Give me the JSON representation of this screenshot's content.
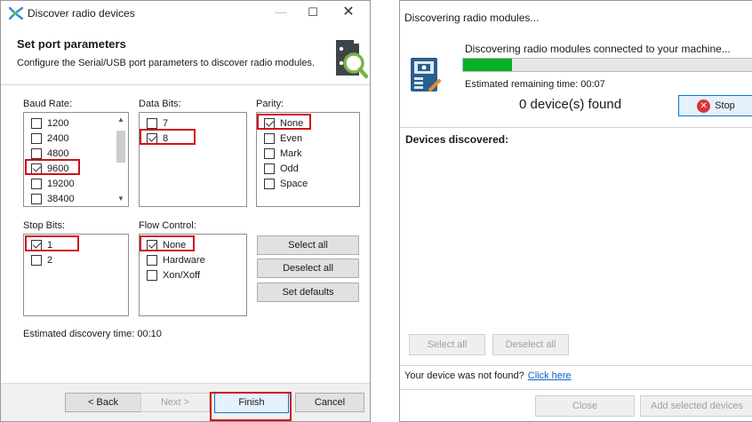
{
  "left_window": {
    "title": "Discover radio devices",
    "title_controls": {
      "minimize": "—",
      "maximize": "☐",
      "close": "✕"
    },
    "heading": "Set port parameters",
    "subheading": "Configure the Serial/USB port parameters to discover radio modules.",
    "baud_rate": {
      "label": "Baud Rate:",
      "options": [
        {
          "label": "1200",
          "checked": false
        },
        {
          "label": "2400",
          "checked": false
        },
        {
          "label": "4800",
          "checked": false
        },
        {
          "label": "9600",
          "checked": true
        },
        {
          "label": "19200",
          "checked": false
        },
        {
          "label": "38400",
          "checked": false
        }
      ]
    },
    "data_bits": {
      "label": "Data Bits:",
      "options": [
        {
          "label": "7",
          "checked": false
        },
        {
          "label": "8",
          "checked": true
        }
      ]
    },
    "parity": {
      "label": "Parity:",
      "options": [
        {
          "label": "None",
          "checked": true
        },
        {
          "label": "Even",
          "checked": false
        },
        {
          "label": "Mark",
          "checked": false
        },
        {
          "label": "Odd",
          "checked": false
        },
        {
          "label": "Space",
          "checked": false
        }
      ]
    },
    "stop_bits": {
      "label": "Stop Bits:",
      "options": [
        {
          "label": "1",
          "checked": true
        },
        {
          "label": "2",
          "checked": false
        }
      ]
    },
    "flow_control": {
      "label": "Flow Control:",
      "options": [
        {
          "label": "None",
          "checked": true
        },
        {
          "label": "Hardware",
          "checked": false
        },
        {
          "label": "Xon/Xoff",
          "checked": false
        }
      ]
    },
    "actions": {
      "select_all": "Select all",
      "deselect_all": "Deselect all",
      "set_defaults": "Set defaults"
    },
    "estimated_time": "Estimated discovery time: 00:10",
    "footer": {
      "back": "< Back",
      "next": "Next >",
      "finish": "Finish",
      "cancel": "Cancel"
    }
  },
  "right_window": {
    "title": "Discovering radio modules...",
    "status": "Discovering radio modules connected to your machine...",
    "progress_percent": 17,
    "eta": "Estimated remaining time: 00:07",
    "found": "0 device(s) found",
    "stop": "Stop",
    "devices_heading": "Devices discovered:",
    "select_all": "Select all",
    "deselect_all": "Deselect all",
    "not_found_text": "Your device was not found?",
    "not_found_link": "Click here",
    "close": "Close",
    "add_selected": "Add selected devices"
  },
  "colors": {
    "highlight": "#d0111b",
    "progress": "#06b025",
    "link": "#0a63c8",
    "stop_icon": "#d8373a"
  }
}
